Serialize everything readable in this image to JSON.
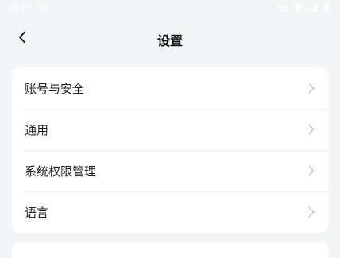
{
  "status_bar": {
    "time": "4:12"
  },
  "header": {
    "title": "设置"
  },
  "settings": {
    "items": [
      {
        "label": "账号与安全"
      },
      {
        "label": "通用"
      },
      {
        "label": "系统权限管理"
      },
      {
        "label": "语言"
      }
    ]
  },
  "icons": {
    "back": "back-arrow-icon",
    "chevron": "chevron-right-icon"
  },
  "colors": {
    "background": "#f4f5f7",
    "card": "#ffffff",
    "chevron": "#c4c4c4",
    "text": "#1f1f1f"
  }
}
